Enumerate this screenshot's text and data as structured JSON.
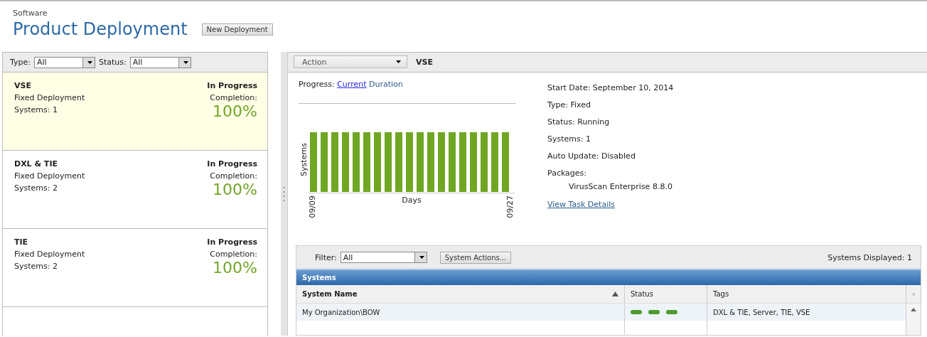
{
  "header": {
    "breadcrumb": "Software",
    "title": "Product Deployment",
    "button": "New Deployment"
  },
  "filters": [
    {
      "label": "Type:",
      "value": "All"
    },
    {
      "label": "Status:",
      "value": "All"
    }
  ],
  "deployments": [
    {
      "name": "VSE",
      "type": "Fixed Deployment",
      "systems": "Systems: 1",
      "status": "In Progress",
      "completion_label": "Completion:",
      "completion": "100%",
      "selected": true
    },
    {
      "name": "DXL & TIE",
      "type": "Fixed Deployment",
      "systems": "Systems: 2",
      "status": "In Progress",
      "completion_label": "Completion:",
      "completion": "100%",
      "selected": false
    },
    {
      "name": "TIE",
      "type": "Fixed Deployment",
      "systems": "Systems: 2",
      "status": "In Progress",
      "completion_label": "Completion:",
      "completion": "100%",
      "selected": false
    }
  ],
  "toolbar": {
    "action": "Action",
    "title": "VSE"
  },
  "progress": {
    "label": "Progress:",
    "views": [
      {
        "label": "Current",
        "selected": true
      },
      {
        "label": "Duration",
        "selected": false
      }
    ]
  },
  "chart": {
    "ylabel": "Systems",
    "xlabel": "Days",
    "x_start": "09/09",
    "x_end": "09/27"
  },
  "details": [
    {
      "kind": "line",
      "text": "Start Date: September 10, 2014"
    },
    {
      "kind": "line",
      "text": "Type: Fixed"
    },
    {
      "kind": "line",
      "text": "Status: Running"
    },
    {
      "kind": "line",
      "text": "Systems: 1"
    },
    {
      "kind": "line",
      "text": "Auto Update: Disabled"
    },
    {
      "kind": "line",
      "text": "Packages:"
    },
    {
      "kind": "indent",
      "text": "VirusScan Enterprise 8.8.0"
    },
    {
      "kind": "link",
      "text": "View Task Details"
    }
  ],
  "systems": {
    "filter_label": "Filter:",
    "filter_value": "All",
    "actions_button": "System Actions...",
    "count": "Systems Displayed: 1",
    "title": "Systems",
    "columns": [
      "System Name",
      "Status",
      "Tags"
    ],
    "rows": [
      {
        "name": "My Organization\\BOW",
        "tags": "DXL & TIE, Server, TIE, VSE"
      }
    ]
  }
}
